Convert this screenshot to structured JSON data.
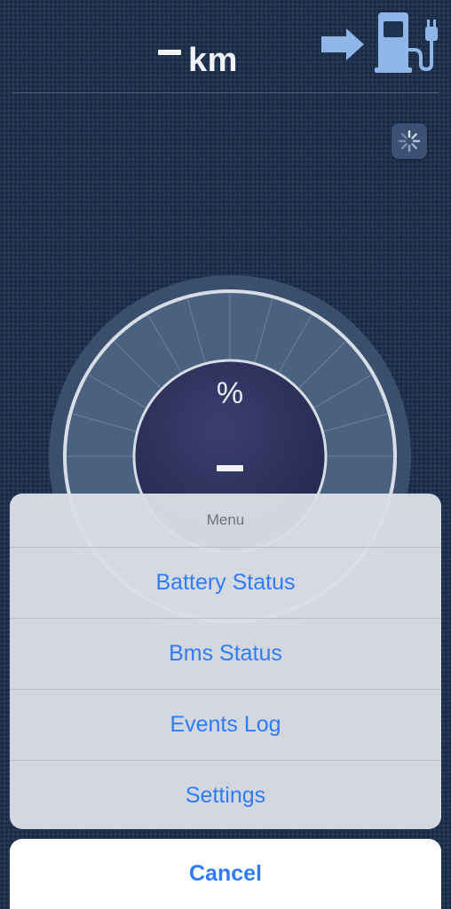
{
  "header": {
    "range_unit": "km",
    "range_value_icon": "dash-placeholder-icon",
    "charge_icon": "arrow-to-charging-station-icon",
    "refresh_icon": "loading-spinner-icon"
  },
  "gauge": {
    "unit_label": "%",
    "value_icon": "dash-placeholder-icon"
  },
  "menu": {
    "title": "Menu",
    "items": [
      {
        "label": "Battery Status"
      },
      {
        "label": "Bms Status"
      },
      {
        "label": "Events Log"
      },
      {
        "label": "Settings"
      }
    ],
    "cancel_label": "Cancel"
  },
  "colors": {
    "background": "#1f3350",
    "accent_blue": "#2f7cf6",
    "icon_blue": "#8fb6e6",
    "gauge_inner": "#2b3058"
  }
}
